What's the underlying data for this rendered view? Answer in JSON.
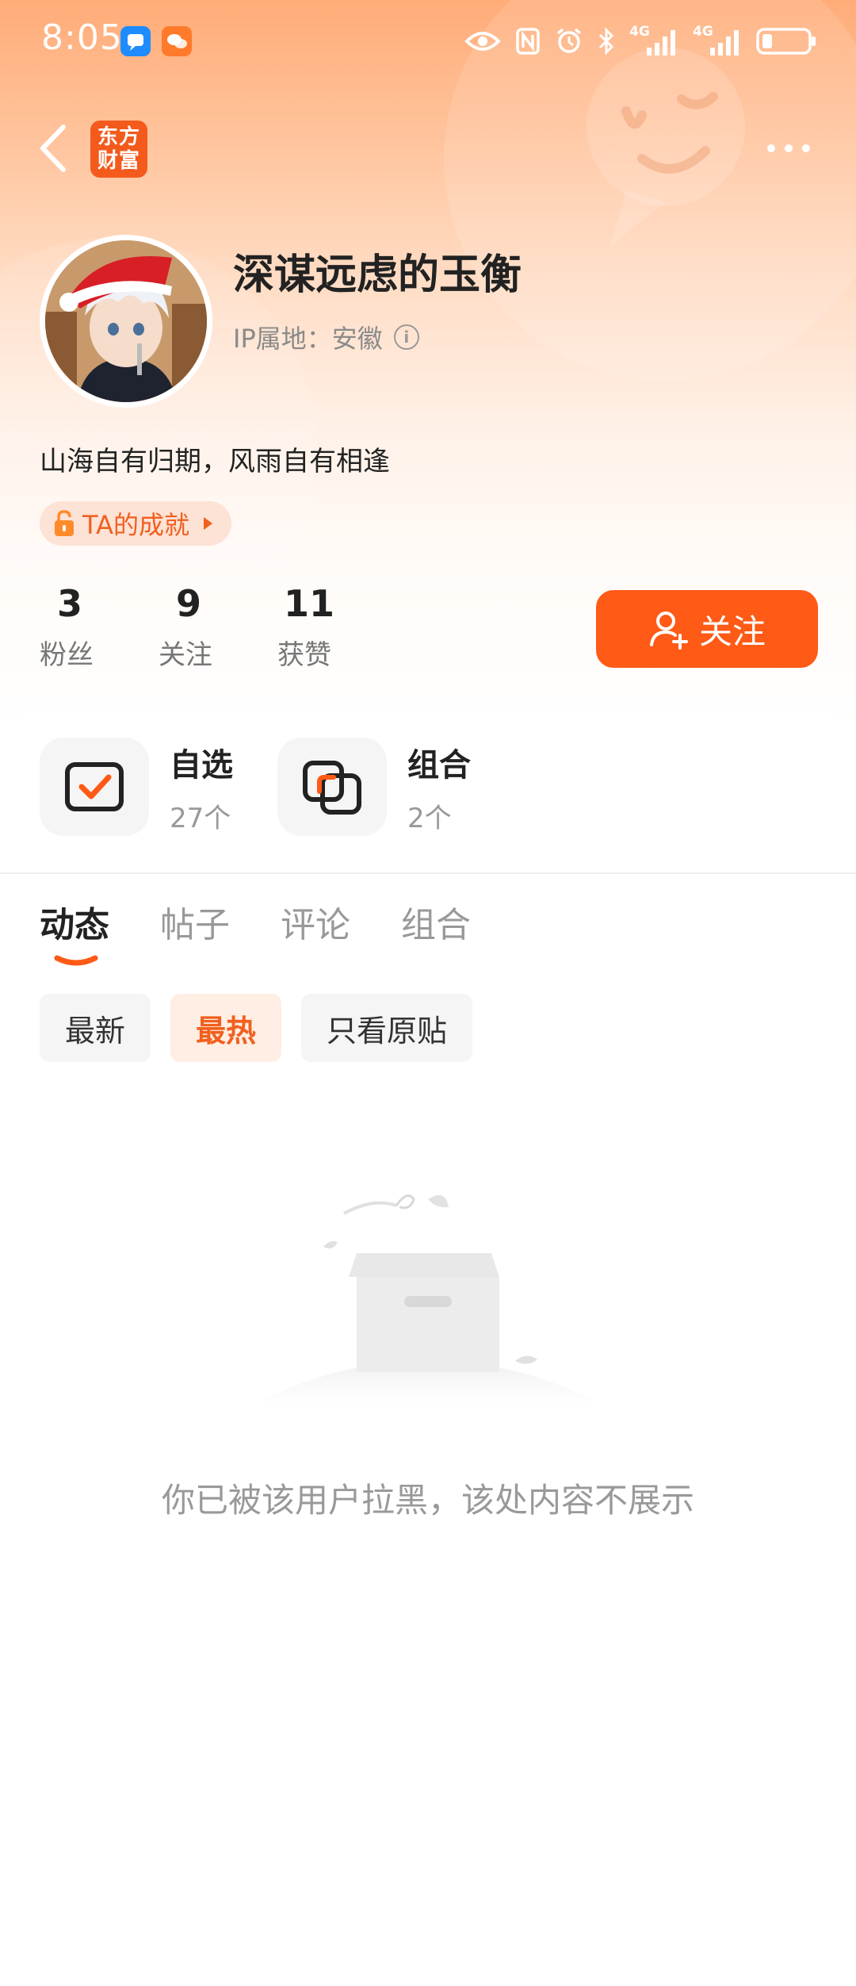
{
  "status_bar": {
    "time": "8:05",
    "net_1": "4G",
    "net_2": "4G"
  },
  "nav": {
    "logo_text": "东方财富"
  },
  "profile": {
    "username": "深谋远虑的玉衡",
    "ip_location": "IP属地：安徽",
    "bio": "山海自有归期，风雨自有相逢",
    "achievement_label": "TA的成就"
  },
  "stats": [
    {
      "count": "3",
      "label": "粉丝"
    },
    {
      "count": "9",
      "label": "关注"
    },
    {
      "count": "11",
      "label": "获赞"
    }
  ],
  "follow_button": "关注",
  "modules": [
    {
      "title": "自选",
      "count": "27个",
      "icon": "watchlist-check-icon"
    },
    {
      "title": "组合",
      "count": "2个",
      "icon": "portfolio-icon"
    }
  ],
  "tabs": [
    "动态",
    "帖子",
    "评论",
    "组合"
  ],
  "active_tab": "动态",
  "filters": [
    "最新",
    "最热",
    "只看原贴"
  ],
  "active_filter": "最热",
  "empty_message": "你已被该用户拉黑，该处内容不展示",
  "colors": {
    "accent": "#ff5a16",
    "accent_text": "#f0601e",
    "header_gradient_top": "#ffac78"
  }
}
